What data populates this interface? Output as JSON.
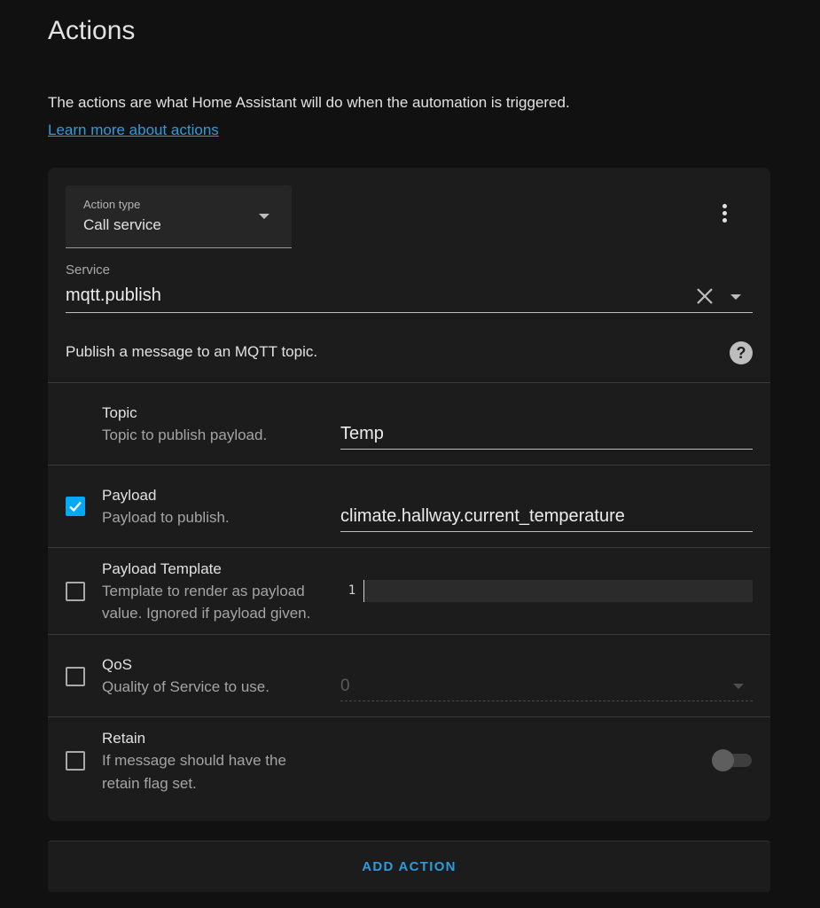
{
  "section": {
    "title": "Actions",
    "intro": "The actions are what Home Assistant will do when the automation is triggered.",
    "learn_more": "Learn more about actions"
  },
  "action": {
    "type_label": "Action type",
    "type_value": "Call service",
    "menu_icon": "dots-vertical-icon",
    "service_label": "Service",
    "service_value": "mqtt.publish",
    "service_description": "Publish a message to an MQTT topic.",
    "help_icon": "help-circle-icon"
  },
  "fields": {
    "topic": {
      "name": "Topic",
      "description": "Topic to publish payload.",
      "value": "Temp"
    },
    "payload": {
      "name": "Payload",
      "description": "Payload to publish.",
      "value": "climate.hallway.current_temperature",
      "checked": true
    },
    "payload_template": {
      "name": "Payload Template",
      "description_line1": "Template to render as payload",
      "description_line2": "value. Ignored if payload given.",
      "line_number": "1",
      "checked": false
    },
    "qos": {
      "name": "QoS",
      "description": "Quality of Service to use.",
      "value": "0",
      "checked": false
    },
    "retain": {
      "name": "Retain",
      "description_line1": "If message should have the",
      "description_line2": "retain flag set.",
      "checked": false,
      "toggle_on": false
    }
  },
  "add_action_label": "ADD ACTION",
  "colors": {
    "accent": "#03a9f4",
    "link": "#2f9bde",
    "background": "#111111",
    "card": "#1c1c1c"
  }
}
